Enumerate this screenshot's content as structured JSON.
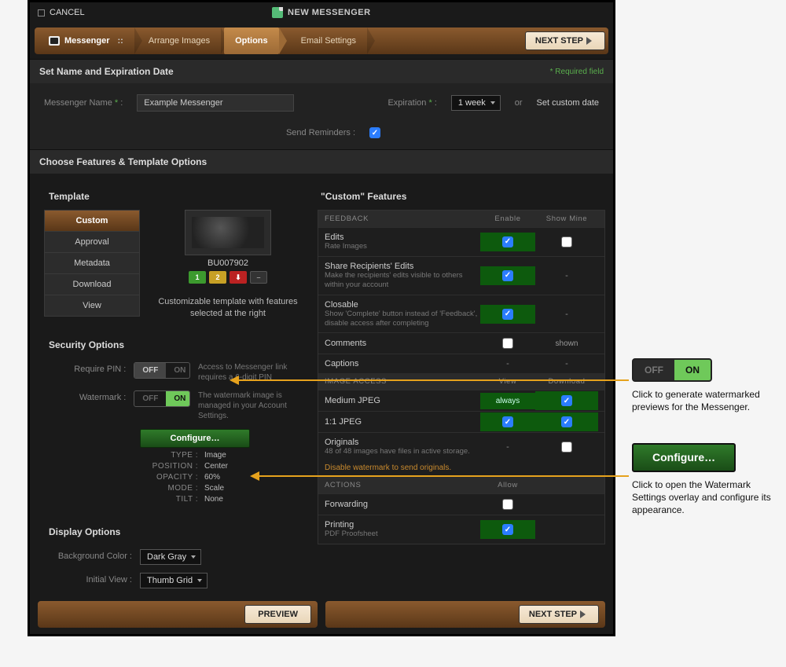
{
  "titlebar": {
    "cancel": "CANCEL",
    "title": "NEW MESSENGER"
  },
  "tabs": {
    "messenger": "Messenger",
    "arrange": "Arrange Images",
    "options": "Options",
    "email": "Email Settings",
    "next": "NEXT STEP"
  },
  "section1": {
    "title": "Set Name and Expiration Date",
    "required_note": "* Required field",
    "name_label": "Messenger Name",
    "name_value": "Example Messenger",
    "expiration_label": "Expiration",
    "expiration_value": "1 week",
    "or": "or",
    "set_custom": "Set custom date",
    "reminders_label": "Send Reminders :"
  },
  "section2": {
    "title": "Choose Features & Template Options"
  },
  "template": {
    "heading": "Template",
    "items": [
      "Custom",
      "Approval",
      "Metadata",
      "Download",
      "View"
    ],
    "image_id": "BU007902",
    "pill_1": "1",
    "pill_2": "2",
    "pill_dash": "–",
    "note": "Customizable template with features selected at the right"
  },
  "security": {
    "heading": "Security Options",
    "require_pin_label": "Require PIN :",
    "off": "OFF",
    "on": "ON",
    "pin_help": "Access to Messenger link requires a 6-digit PIN",
    "watermark_label": "Watermark :",
    "watermark_help": "The watermark image is managed in your Account Settings.",
    "configure": "Configure…",
    "kv": {
      "type_k": "TYPE :",
      "type_v": "Image",
      "pos_k": "POSITION :",
      "pos_v": "Center",
      "opa_k": "OPACITY :",
      "opa_v": "60%",
      "mode_k": "MODE :",
      "mode_v": "Scale",
      "tilt_k": "TILT :",
      "tilt_v": "None"
    }
  },
  "display": {
    "heading": "Display Options",
    "bg_label": "Background Color :",
    "bg_value": "Dark Gray",
    "view_label": "Initial View :",
    "view_value": "Thumb Grid"
  },
  "features": {
    "heading": "\"Custom\"  Features",
    "feedback_hdr": "FEEDBACK",
    "enable": "Enable",
    "show_mine": "Show Mine",
    "edits": "Edits",
    "edits_sub": "Rate Images",
    "share": "Share Recipients' Edits",
    "share_sub": "Make the recipients' edits visible to others within your account",
    "closable": "Closable",
    "closable_sub": "Show 'Complete' button instead of 'Feedback', disable access after completing",
    "comments": "Comments",
    "shown": "shown",
    "captions": "Captions",
    "image_access_hdr": "IMAGE ACCESS",
    "view_col": "View",
    "download_col": "Download",
    "medium": "Medium JPEG",
    "always": "always",
    "jpeg11": "1:1 JPEG",
    "originals": "Originals",
    "originals_sub": "48 of 48 images have files in active storage.",
    "originals_warn": "Disable watermark to send originals.",
    "actions_hdr": "ACTIONS",
    "allow": "Allow",
    "forwarding": "Forwarding",
    "printing": "Printing",
    "printing_sub": "PDF Proofsheet"
  },
  "footer": {
    "preview": "PREVIEW",
    "next": "NEXT STEP"
  },
  "callouts": {
    "on_text": "Click to generate watermarked previews for the Messenger.",
    "config_text": "Click to open the Watermark Settings overlay and configure its appearance.",
    "off": "OFF",
    "on": "ON",
    "configure": "Configure…"
  }
}
